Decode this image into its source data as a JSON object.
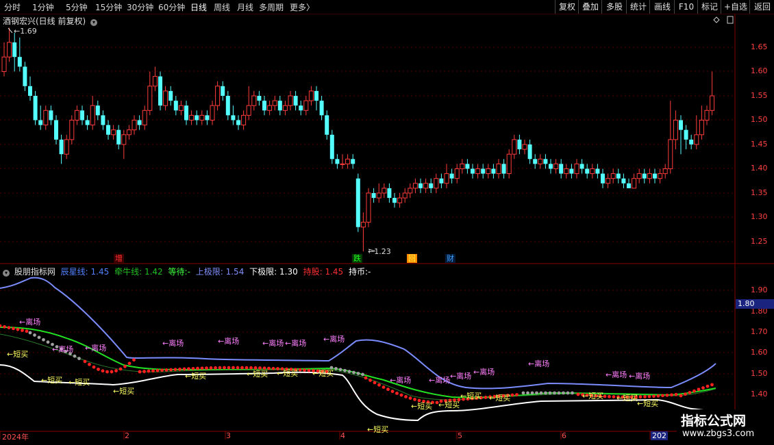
{
  "toolbar": {
    "periods": [
      "分时",
      "1分钟",
      "5分钟",
      "15分钟",
      "30分钟",
      "60分钟",
      "日线",
      "周线",
      "月线",
      "多周期",
      "更多"
    ],
    "active_period": "日线",
    "more_arrow": "〉",
    "right_buttons": [
      "复权",
      "叠加",
      "多股",
      "统计",
      "画线",
      "F10",
      "标记",
      "+自选",
      "返回"
    ]
  },
  "main_chart": {
    "title": "酒钢宏兴(日线 前复权)",
    "price_axis": [
      "1.65",
      "1.60",
      "1.55",
      "1.50",
      "1.45",
      "1.40",
      "1.35",
      "1.30",
      "1.25"
    ],
    "high_label": "1.69",
    "low_label": "1.23",
    "markers": [
      {
        "text": "增",
        "color": "#ff3030"
      },
      {
        "text": "跌",
        "color": "#20ff20"
      },
      {
        "text": "回",
        "color": "#ffff40"
      },
      {
        "text": "财",
        "color": "#40a0ff"
      }
    ],
    "colors": {
      "up": "#ff3c3c",
      "down": "#54ffff",
      "grid": "#5a0000"
    }
  },
  "indicator": {
    "name": "股朋指标网",
    "items": [
      {
        "label": "辰星线:",
        "value": "1.45",
        "color": "#5080ff"
      },
      {
        "label": "牵牛线:",
        "value": "1.42",
        "color": "#20c020"
      },
      {
        "label": "等待:",
        "value": "-",
        "color": "#40ff40"
      },
      {
        "label": "上极限:",
        "value": "1.54",
        "color": "#8090ff"
      },
      {
        "label": "下极限:",
        "value": "1.30",
        "color": "#ffffff"
      },
      {
        "label": "持股:",
        "value": "1.45",
        "color": "#ff3030"
      },
      {
        "label": "持币:",
        "value": "-",
        "color": "#ffffff"
      }
    ],
    "axis": [
      "1.90",
      "1.80",
      "1.70",
      "1.60",
      "1.50",
      "1.40"
    ],
    "current_tag": "1.80",
    "leave_text": "←离场",
    "buy_text": "←短买",
    "colors": {
      "upper": "#7b8cff",
      "lower": "#ffffff",
      "niu": "#22e022",
      "hold": "#ff2020",
      "wait": "#a0a0a0",
      "leave": "#ff80ff",
      "buy": "#ffff60"
    }
  },
  "time_axis": [
    "2024年",
    "2",
    "3",
    "4",
    "5",
    "6",
    "202"
  ],
  "watermark": {
    "title": "指标公式网",
    "url": "www.zbgs3.com"
  }
}
